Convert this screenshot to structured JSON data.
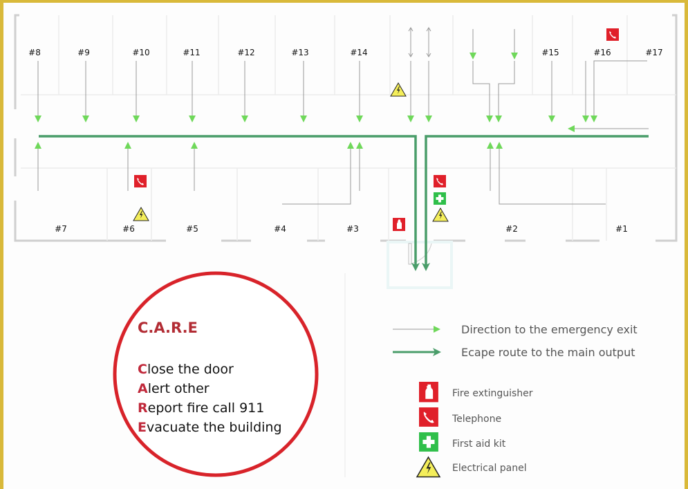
{
  "rooms_top": [
    {
      "id": "#8"
    },
    {
      "id": "#9"
    },
    {
      "id": "#10"
    },
    {
      "id": "#11"
    },
    {
      "id": "#12"
    },
    {
      "id": "#13"
    },
    {
      "id": "#14"
    },
    {
      "id": "#15"
    },
    {
      "id": "#16"
    },
    {
      "id": "#17"
    }
  ],
  "rooms_bottom": [
    {
      "id": "#7"
    },
    {
      "id": "#6"
    },
    {
      "id": "#5"
    },
    {
      "id": "#4"
    },
    {
      "id": "#3"
    },
    {
      "id": "#2"
    },
    {
      "id": "#1"
    }
  ],
  "care": {
    "title": "C.A.R.E",
    "steps": [
      {
        "initial": "C",
        "rest": "lose the door"
      },
      {
        "initial": "A",
        "rest": "lert other"
      },
      {
        "initial": "R",
        "rest": "eport fire call 911"
      },
      {
        "initial": "E",
        "rest": "vacuate the building"
      }
    ]
  },
  "legend": {
    "lines": [
      {
        "label": "Direction to the emergency exit",
        "style": "thin-light-green-arrow"
      },
      {
        "label": "Ecape route to the main output",
        "style": "thick-dark-green-arrow"
      }
    ],
    "icons": [
      {
        "label": "Fire extinguisher",
        "icon": "fire-extinguisher-icon"
      },
      {
        "label": "Telephone",
        "icon": "telephone-icon"
      },
      {
        "label": "First aid kit",
        "icon": "first-aid-icon"
      },
      {
        "label": "Electrical panel",
        "icon": "electrical-panel-icon"
      }
    ]
  },
  "colors": {
    "direction_arrow": "#6fd85a",
    "escape_route": "#4a9d6a",
    "care_ring": "#d8232a",
    "sign_red": "#e0202a",
    "sign_green": "#2fbf4a",
    "warning_yellow": "#f4ee5a",
    "frame": "#d9b93a"
  }
}
